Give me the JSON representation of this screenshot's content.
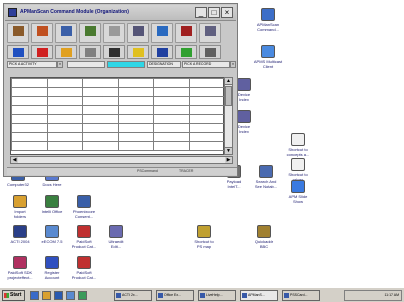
{
  "window": {
    "title": "APManScan Command Module (Organization)",
    "buttons": {
      "minimize": "_",
      "maximize": "□",
      "close": "×"
    },
    "toolbar1": [
      {
        "name": "companies",
        "label": "",
        "icon": "briefcase-icon",
        "color": "#8a5a2a"
      },
      {
        "name": "contacts",
        "label": "",
        "icon": "person-icon",
        "color": "#c05020"
      },
      {
        "name": "projects",
        "label": "",
        "icon": "folder-icon",
        "color": "#3a5fa8"
      },
      {
        "name": "calendar",
        "label": "",
        "icon": "calendar-icon",
        "color": "#4a7a30"
      },
      {
        "name": "notes",
        "label": "",
        "icon": "note-icon",
        "color": "#9a9a9a"
      },
      {
        "name": "reports",
        "label": "",
        "icon": "printer-icon",
        "color": "#557"
      },
      {
        "name": "mail",
        "label": "",
        "icon": "mail-icon",
        "color": "#2a6ac0"
      },
      {
        "name": "tools",
        "label": "",
        "icon": "tools-icon",
        "color": "#a02020"
      },
      {
        "name": "exit",
        "label": "",
        "icon": "exit-icon",
        "color": "#606080"
      }
    ],
    "toolbar2": [
      {
        "name": "refresh",
        "icon": "refresh-icon",
        "color": "#2050c0"
      },
      {
        "name": "flag",
        "icon": "flag-icon",
        "color": "#d02020"
      },
      {
        "name": "shield",
        "icon": "shield-icon",
        "color": "#e0a020"
      },
      {
        "name": "clip",
        "icon": "clip-icon",
        "color": "#808080"
      },
      {
        "name": "eye",
        "icon": "eye-icon",
        "color": "#303030"
      },
      {
        "name": "star",
        "icon": "star-icon",
        "color": "#e0c020"
      },
      {
        "name": "help",
        "icon": "help-icon",
        "color": "#2040a0"
      },
      {
        "name": "chart",
        "icon": "chart-icon",
        "color": "#30a030"
      },
      {
        "name": "search",
        "icon": "search-icon",
        "color": "#606060"
      }
    ],
    "filter": {
      "record_select": "PICK A ACTIVITY",
      "mid_label": "",
      "highlight_color": "#2ed6e6",
      "field_label": "DESIGNATION",
      "record_select2": "PICK A RECORD"
    },
    "grid": {
      "rows": 8,
      "cols": 6
    },
    "status": {
      "left": "",
      "center": "PSCommand",
      "right": "TRACER"
    }
  },
  "desktop_icons": [
    {
      "id": "apman-cmd",
      "label": "APManScan\nCommand...",
      "color": "#3c6ec8"
    },
    {
      "id": "apman-ms",
      "label": "APMS Multicast\nClient",
      "color": "#4a8ae0"
    },
    {
      "id": "icon-3",
      "label": "Device\nIndex",
      "color": "#6060a0"
    },
    {
      "id": "icon-4",
      "label": "Device\nIndex",
      "color": "#6060a0"
    },
    {
      "id": "shortcut-1",
      "label": "Shortcut to\nconcepts a...",
      "color": "#9a9a9a"
    },
    {
      "id": "shortcut-2",
      "label": "Shortcut to\nprices",
      "color": "#9a9a9a"
    },
    {
      "id": "payload",
      "label": "Payload\nIntelT...",
      "color": "#707070"
    },
    {
      "id": "search-files",
      "label": "Search And\nSee Notab...",
      "color": "#4a6ab0"
    },
    {
      "id": "apm-show",
      "label": "APM Slide\nShow",
      "color": "#3a7ae0"
    },
    {
      "id": "computer",
      "label": "Computer32",
      "color": "#3a5fa8"
    },
    {
      "id": "docs",
      "label": "Docs Here",
      "color": "#5a7ad0"
    },
    {
      "id": "import",
      "label": "Import\nfolders",
      "color": "#d8a030"
    },
    {
      "id": "intelli",
      "label": "Intelli Office",
      "color": "#3a8040"
    },
    {
      "id": "phoenix",
      "label": "Phoenixcore\nConsent...",
      "color": "#3a5fa8"
    },
    {
      "id": "acti",
      "label": "ACTI 2004",
      "color": "#2a3f88"
    },
    {
      "id": "ecom",
      "label": "eECOM 7.5",
      "color": "#5a8ad0"
    },
    {
      "id": "paid-product",
      "label": "PaidSoft\nProduct Cat...",
      "color": "#c03030"
    },
    {
      "id": "ultraedit",
      "label": "Ultraedit\nEdit...",
      "color": "#6a6ab0"
    },
    {
      "id": "shortcut-3",
      "label": "Shortcut to\nPS map",
      "color": "#c0a030"
    },
    {
      "id": "quickaddr",
      "label": "Quickaddr\nBBC",
      "color": "#a08030"
    },
    {
      "id": "paid-sdk",
      "label": "PaidSoft SDK\nprojecteffect...",
      "color": "#b03060"
    },
    {
      "id": "register",
      "label": "Register\nAccount",
      "color": "#3050c0"
    },
    {
      "id": "paid-cat2",
      "label": "PaidSoft\nProduct Cat...",
      "color": "#c03030"
    }
  ],
  "taskbar": {
    "start": "Start",
    "buttons": [
      "ACTI 2x...",
      "Office Ex...",
      "LiveHelp...",
      "APManS...",
      "PSSCard..."
    ],
    "clock": "11:17 AM"
  }
}
